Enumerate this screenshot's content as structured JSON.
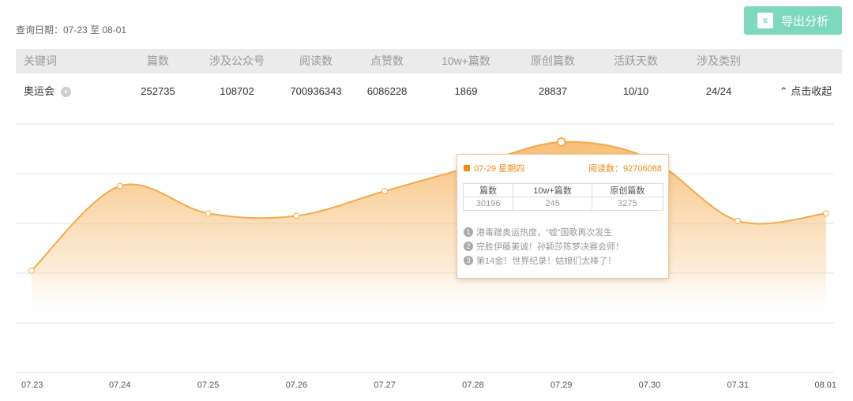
{
  "query_date": "查询日期：07-23 至 08-01",
  "export_button": {
    "icon_text": "x",
    "label": "导出分析"
  },
  "table": {
    "headers": [
      "关键词",
      "篇数",
      "涉及公众号",
      "阅读数",
      "点赞数",
      "10w+篇数",
      "原创篇数",
      "活跃天数",
      "涉及类别"
    ],
    "row": [
      "奥运会",
      "252735",
      "108702",
      "700936343",
      "6086228",
      "1869",
      "28837",
      "10/10",
      "24/24"
    ],
    "expand_icon": "+",
    "collapse_label": "点击收起"
  },
  "tooltip": {
    "date": "07-29 星期四",
    "reads": "阅读数：92706088",
    "headers": [
      "篇数",
      "10w+篇数",
      "原创篇数"
    ],
    "values": [
      "30196",
      "245",
      "3275"
    ],
    "news": [
      {
        "n": "1",
        "t": "港毒蹭奥运热度，“嘘”国歌再次发生"
      },
      {
        "n": "2",
        "t": "完胜伊藤美诚！孙颖莎陈梦决赛会师！"
      },
      {
        "n": "3",
        "t": "第14金！世界纪录！姑娘们太棒了！"
      }
    ]
  },
  "chart_data": {
    "type": "area",
    "title": "",
    "xlabel": "",
    "ylabel": "阅读数",
    "categories": [
      "07.23",
      "07.24",
      "07.25",
      "07.26",
      "07.27",
      "07.28",
      "07.29",
      "07.30",
      "07.31",
      "08.01"
    ],
    "values": [
      41000000,
      75000000,
      64000000,
      63000000,
      73000000,
      83000000,
      92706088,
      86000000,
      61000000,
      64000000
    ],
    "ylim": [
      0,
      100000000
    ],
    "grid": true,
    "highlight_index": 6,
    "color": "#f5a94a"
  }
}
